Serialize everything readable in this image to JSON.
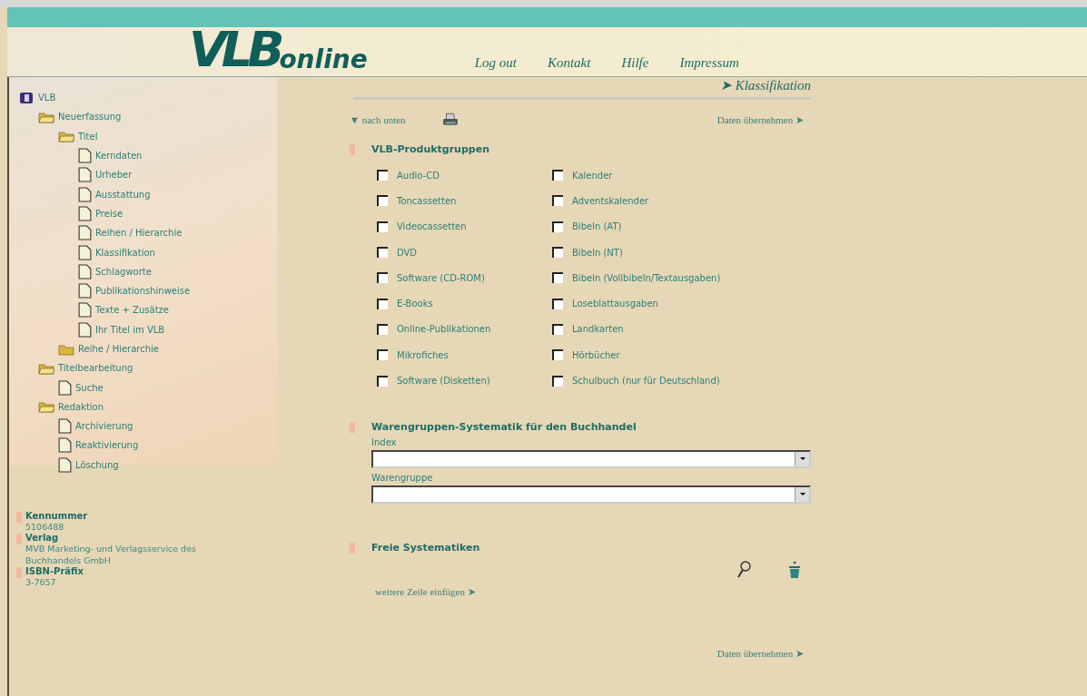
{
  "header": {
    "logo": {
      "big": "VLB",
      "small": "online"
    },
    "nav": [
      "Log out",
      "Kontakt",
      "Hilfe",
      "Impressum"
    ],
    "breadcrumb": "➤ Klassifikation"
  },
  "tree": [
    {
      "label": "VLB",
      "kind": "root",
      "children": [
        {
          "label": "Neuerfassung",
          "kind": "folder",
          "expanded": true,
          "children": [
            {
              "label": "Titel",
              "kind": "folder",
              "expanded": true,
              "children": [
                {
                  "label": "Kerndaten",
                  "kind": "doc"
                },
                {
                  "label": "Urheber",
                  "kind": "doc"
                },
                {
                  "label": "Ausstattung",
                  "kind": "doc"
                },
                {
                  "label": "Preise",
                  "kind": "doc"
                },
                {
                  "label": "Reihen / Hierarchie",
                  "kind": "doc"
                },
                {
                  "label": "Klassifikation",
                  "kind": "doc"
                },
                {
                  "label": "Schlagworte",
                  "kind": "doc"
                },
                {
                  "label": "Publikationshinweise",
                  "kind": "doc"
                },
                {
                  "label": "Texte + Zusätze",
                  "kind": "doc"
                },
                {
                  "label": "Ihr Titel im VLB",
                  "kind": "doc"
                }
              ]
            },
            {
              "label": "Reihe / Hierarchie",
              "kind": "folder",
              "expanded": false
            }
          ]
        },
        {
          "label": "Titelbearbeitung",
          "kind": "folder",
          "expanded": true,
          "children": [
            {
              "label": "Suche",
              "kind": "doc"
            }
          ]
        },
        {
          "label": "Redaktion",
          "kind": "folder",
          "expanded": true,
          "children": [
            {
              "label": "Archivierung",
              "kind": "doc"
            },
            {
              "label": "Reaktivierung",
              "kind": "doc"
            },
            {
              "label": "Löschung",
              "kind": "doc"
            }
          ]
        }
      ]
    }
  ],
  "info": [
    {
      "label": "Kennummer",
      "value": "5106488"
    },
    {
      "label": "Verlag",
      "value": "MVB Marketing- und Verlagsservice des Buchhandels GmbH"
    },
    {
      "label": "ISBN-Präfix",
      "value": "3-7657"
    }
  ],
  "toolbar": {
    "down_link": "▼ nach unten",
    "submit_link": "Daten übernehmen ➤"
  },
  "product_groups": {
    "title": "VLB-Produktgruppen",
    "columns": [
      [
        {
          "label": "Audio-CD",
          "checked": false
        },
        {
          "label": "Toncassetten",
          "checked": false
        },
        {
          "label": "Videocassetten",
          "checked": false
        },
        {
          "label": "DVD",
          "checked": false
        },
        {
          "label": "Software (CD-ROM)",
          "checked": false
        },
        {
          "label": "E-Books",
          "checked": false
        },
        {
          "label": "Online-Publikationen",
          "checked": false
        },
        {
          "label": "Mikrofiches",
          "checked": false
        },
        {
          "label": "Software (Disketten)",
          "checked": false
        }
      ],
      [
        {
          "label": "Kalender",
          "checked": false
        },
        {
          "label": "Adventskalender",
          "checked": false
        },
        {
          "label": "Bibeln (AT)",
          "checked": false
        },
        {
          "label": "Bibeln (NT)",
          "checked": false
        },
        {
          "label": "Bibeln (Vollbibeln/Textausgaben)",
          "checked": false
        },
        {
          "label": "Loseblattausgaben",
          "checked": false
        },
        {
          "label": "Landkarten",
          "checked": false
        },
        {
          "label": "Hörbücher",
          "checked": false
        },
        {
          "label": "Schulbuch (nur für Deutschland)",
          "checked": false
        }
      ]
    ]
  },
  "warengruppen": {
    "title": "Warengruppen-Systematik für den Buchhandel",
    "fields": [
      {
        "label": "Index"
      },
      {
        "label": "Warengruppe"
      }
    ]
  },
  "freie": {
    "title": "Freie Systematiken",
    "add_link": "weitere Zeile einfügen ➤"
  },
  "bottom_link": "Daten übernehmen ➤"
}
